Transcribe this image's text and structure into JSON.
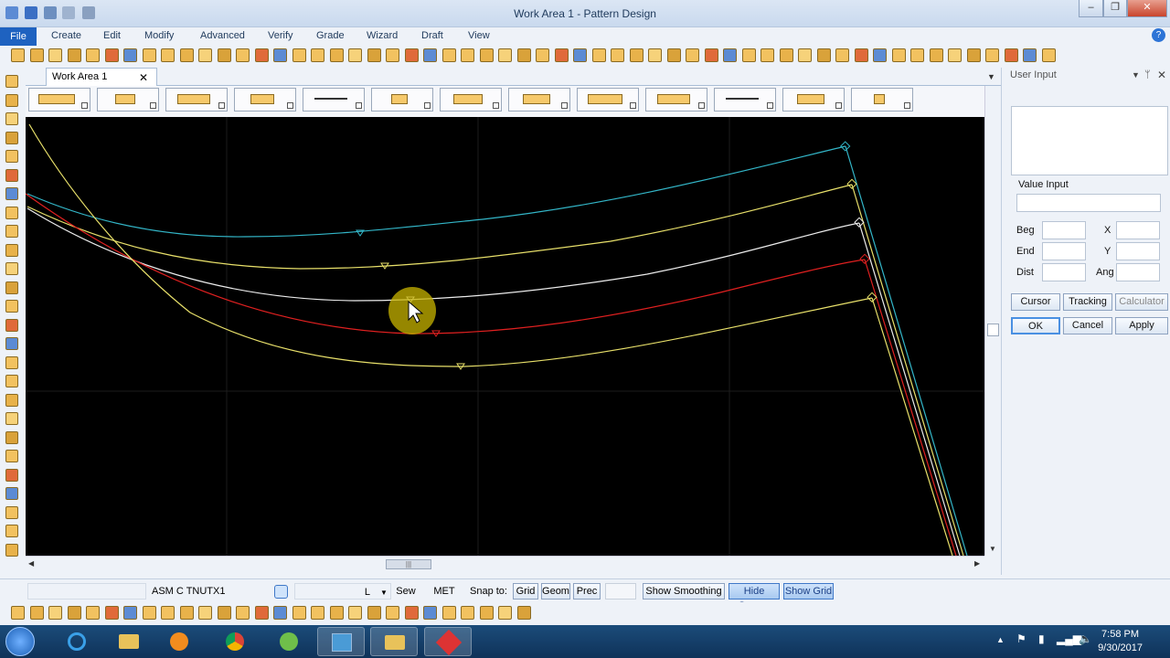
{
  "window": {
    "title": "Work Area 1 - Pattern Design",
    "minimize": "–",
    "maximize": "❐",
    "close": "✕"
  },
  "menu": {
    "items": [
      "File",
      "Create",
      "Edit",
      "Modify",
      "Advanced",
      "Verify",
      "Grade",
      "Wizard",
      "Draft",
      "View"
    ]
  },
  "tab": {
    "label": "Work Area 1",
    "close": "✕"
  },
  "panel": {
    "title": "User Input",
    "value_input_label": "Value Input",
    "beg_label": "Beg",
    "end_label": "End",
    "dist_label": "Dist",
    "x_label": "X",
    "y_label": "Y",
    "ang_label": "Ang",
    "cursor_button": "Cursor",
    "tracking_button": "Tracking",
    "calculator_button": "Calculator",
    "ok_button": "OK",
    "cancel_button": "Cancel",
    "apply_button": "Apply"
  },
  "status": {
    "piece_name": "ASM C TNUTX1",
    "size": "L",
    "sew_button": "Sew",
    "units_button": "MET",
    "snap_label": "Snap to:",
    "grid_button": "Grid",
    "geom_button": "Geom",
    "prec_button": "Prec",
    "show_smoothing_button": "Show Smoothing",
    "hide_seams_button": "Hide Seams",
    "show_grid_button": "Show Grid"
  },
  "taskbar": {
    "time": "7:58 PM",
    "date": "9/30/2017"
  },
  "colors": {
    "curve_cyan": "#33b6c8",
    "curve_yellow": "#e8e06a",
    "curve_white": "#ececec",
    "curve_red": "#e02020",
    "highlight": "#c8b400"
  }
}
